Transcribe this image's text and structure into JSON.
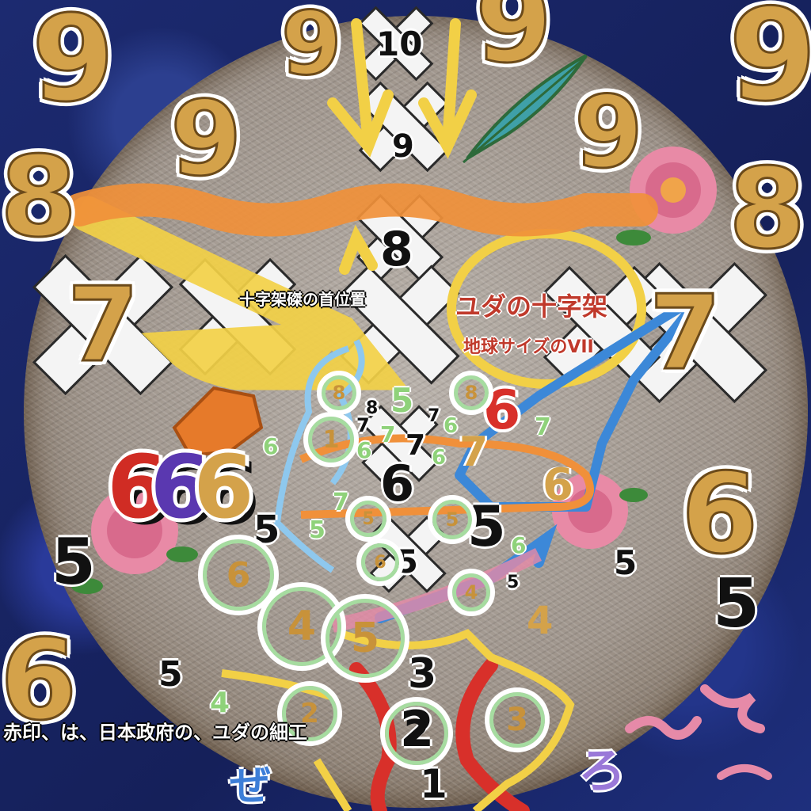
{
  "labels": {
    "neck": "十字架磔の首位置",
    "judas_cross": "ユダの十字架",
    "earth_size": "地球サイズのVII",
    "red_mark": "赤印、は、日本政府の、ユダの細工",
    "ze": "ぜ",
    "ro": "ろ"
  },
  "outer_numbers": {
    "n9_tl": "9",
    "n9_top1": "9",
    "n9_top2": "9",
    "n9_tr": "9",
    "n9_mid": "9",
    "n9_right": "9",
    "n8_left": "8",
    "n8_right": "8",
    "n7_left": "7",
    "n7_right": "7",
    "n6_right": "6",
    "n6_bl": "6",
    "n666": "666",
    "n5_left": "5",
    "n5_right": "5"
  },
  "axis_numbers": {
    "a10": "10",
    "a9": "9",
    "a8": "8",
    "a6": "6",
    "a5": "5",
    "a3": "3",
    "a2": "2",
    "a1": "1"
  },
  "small_numbers": {
    "s8a": "8",
    "s5a": "5",
    "s7a": "7",
    "s6big": "6",
    "s7b": "7",
    "s7c": "7",
    "s7d": "7",
    "s6a": "6",
    "s6b": "6",
    "s6c": "6",
    "s6d": "6",
    "s6e": "6",
    "s6f": "6",
    "s5b": "5",
    "s5c": "5",
    "s5d": "5",
    "s5e": "5",
    "s5f": "5",
    "s4a": "4",
    "s4b": "4",
    "s5g": "5"
  },
  "circled_numbers": {
    "c8a": "8",
    "c8b": "8",
    "c1": "1",
    "c5a": "5",
    "c5b": "5",
    "c6a": "6",
    "c6b": "6",
    "c4a": "4",
    "c5c": "5",
    "c4b": "4",
    "c2a": "2",
    "c2b": "2",
    "c3": "3"
  },
  "colors": {
    "gold": "#d4a24a",
    "orange": "#f0903a",
    "yellow": "#f2d046",
    "blue": "#3c88d8",
    "red": "#d8302a",
    "pink": "#e68aa8",
    "green": "#8fd27a",
    "crimson": "#c0392b"
  }
}
